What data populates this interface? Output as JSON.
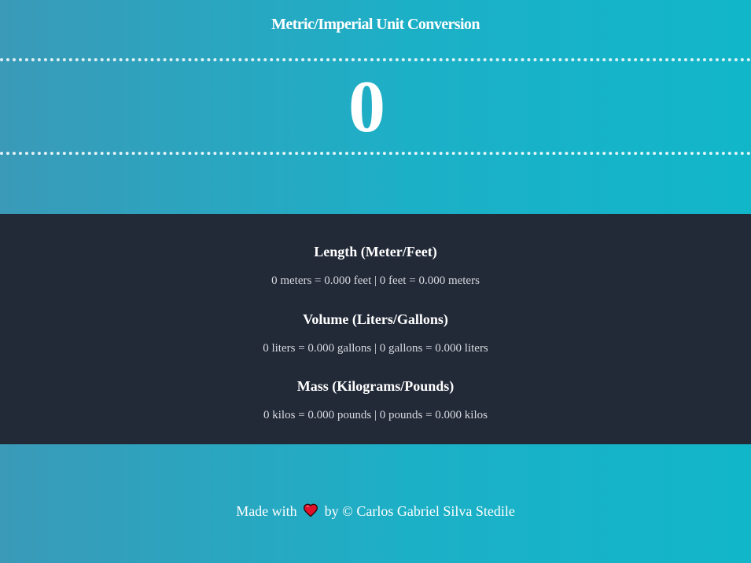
{
  "header": {
    "title": "Metric/Imperial Unit Conversion"
  },
  "converter": {
    "input_value": "0"
  },
  "results": [
    {
      "heading": "Length (Meter/Feet)",
      "text": "0 meters = 0.000 feet | 0 feet = 0.000 meters"
    },
    {
      "heading": "Volume (Liters/Gallons)",
      "text": "0 liters = 0.000 gallons | 0 gallons = 0.000 liters"
    },
    {
      "heading": "Mass (Kilograms/Pounds)",
      "text": "0 kilos = 0.000 pounds | 0 pounds = 0.000 kilos"
    }
  ],
  "footer": {
    "made_with": "Made with",
    "heart_icon": "heart-icon",
    "credit": "by © Carlos Gabriel Silva Stedile"
  },
  "colors": {
    "gradient_start": "#3a9ab8",
    "gradient_end": "#12b6c9",
    "panel_background": "#222937",
    "heart": "#e0112b"
  }
}
